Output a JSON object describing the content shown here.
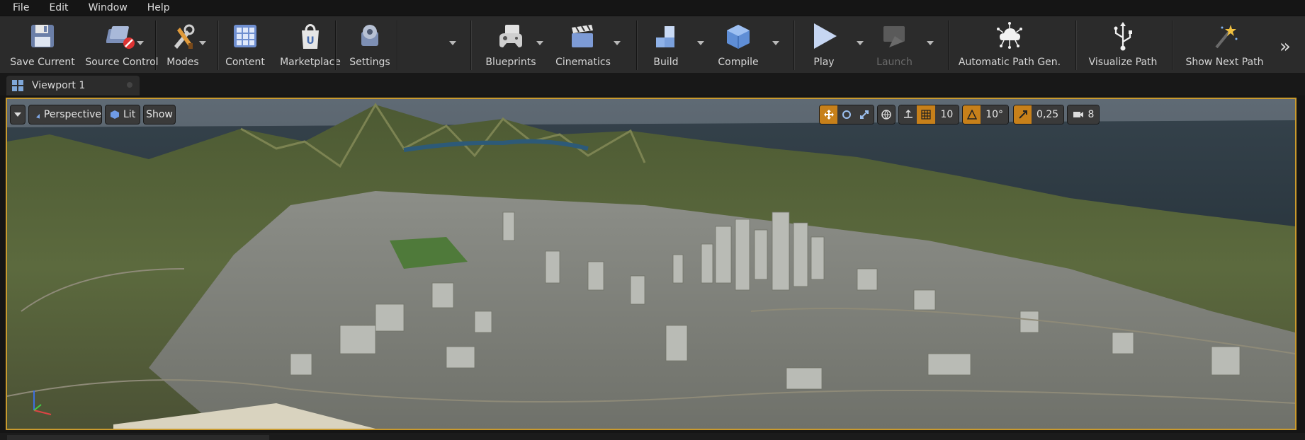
{
  "menu": [
    "File",
    "Edit",
    "Window",
    "Help"
  ],
  "toolbar": {
    "save_current": "Save Current",
    "source_control": "Source Control",
    "modes": "Modes",
    "content": "Content",
    "marketplace": "Marketplace",
    "settings": "Settings",
    "blueprints": "Blueprints",
    "cinematics": "Cinematics",
    "build": "Build",
    "compile": "Compile",
    "play": "Play",
    "launch": "Launch",
    "automatic_path_gen": "Automatic Path Gen.",
    "visualize_path": "Visualize Path",
    "show_next_path": "Show Next Path",
    "more": "»"
  },
  "tab": {
    "label": "Viewport 1"
  },
  "viewport": {
    "perspective": "Perspective",
    "lit": "Lit",
    "show": "Show",
    "grid_snap": "10",
    "rotation_snap": "10°",
    "scale_snap": "0,25",
    "camera_speed": "8"
  },
  "colors": {
    "accent": "#c7801a",
    "viewport_border": "#c99a2e",
    "toolbar_bg": "#2b2b2b",
    "menu_bg": "#151515"
  },
  "icons": {
    "save": "floppy-disk-icon",
    "source_control": "source-control-icon",
    "modes": "wrench-brush-icon",
    "content": "content-browser-icon",
    "marketplace": "marketplace-bag-icon",
    "settings": "gear-icon",
    "blueprints": "gamepad-icon",
    "cinematics": "clapperboard-icon",
    "build": "blocks-icon",
    "compile": "cube-icon",
    "play": "play-icon",
    "launch": "launch-icon",
    "auto_path": "cloud-network-icon",
    "visualize": "usb-icon",
    "show_next": "magic-wand-icon"
  }
}
